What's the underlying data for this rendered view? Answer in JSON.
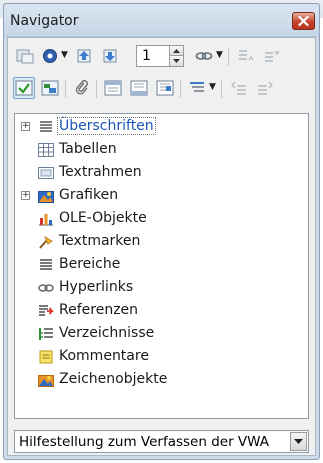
{
  "window": {
    "title": "Navigator"
  },
  "toolbar": {
    "page_number": "1",
    "row1": [
      "toggle-icon",
      "navigation-icon",
      "previous-icon",
      "next-icon",
      "page-spin",
      "drag-mode-icon",
      "promote-level-icon",
      "demote-level-icon"
    ],
    "row2": [
      "content-view-icon",
      "list-box-icon",
      "set-reminder-icon",
      "header-icon",
      "footer-icon",
      "anchor-icon",
      "heading-levels-icon",
      "promote-chapter-icon",
      "demote-chapter-icon"
    ]
  },
  "tree": {
    "items": [
      {
        "label": "Überschriften",
        "icon": "headings-icon",
        "expandable": true,
        "selected": true
      },
      {
        "label": "Tabellen",
        "icon": "table-icon",
        "expandable": false
      },
      {
        "label": "Textrahmen",
        "icon": "text-frame-icon",
        "expandable": false
      },
      {
        "label": "Grafiken",
        "icon": "graphics-icon",
        "expandable": true
      },
      {
        "label": "OLE-Objekte",
        "icon": "ole-object-icon",
        "expandable": false
      },
      {
        "label": "Textmarken",
        "icon": "bookmark-icon",
        "expandable": false
      },
      {
        "label": "Bereiche",
        "icon": "section-icon",
        "expandable": false
      },
      {
        "label": "Hyperlinks",
        "icon": "hyperlink-icon",
        "expandable": false
      },
      {
        "label": "Referenzen",
        "icon": "reference-icon",
        "expandable": false
      },
      {
        "label": "Verzeichnisse",
        "icon": "index-icon",
        "expandable": false
      },
      {
        "label": "Kommentare",
        "icon": "comment-icon",
        "expandable": false
      },
      {
        "label": "Zeichenobjekte",
        "icon": "drawing-object-icon",
        "expandable": false
      }
    ]
  },
  "document_select": {
    "value": "Hilfestellung zum Verfassen der VWA"
  },
  "colors": {
    "accent": "#1a56b6",
    "close": "#c7442c"
  }
}
